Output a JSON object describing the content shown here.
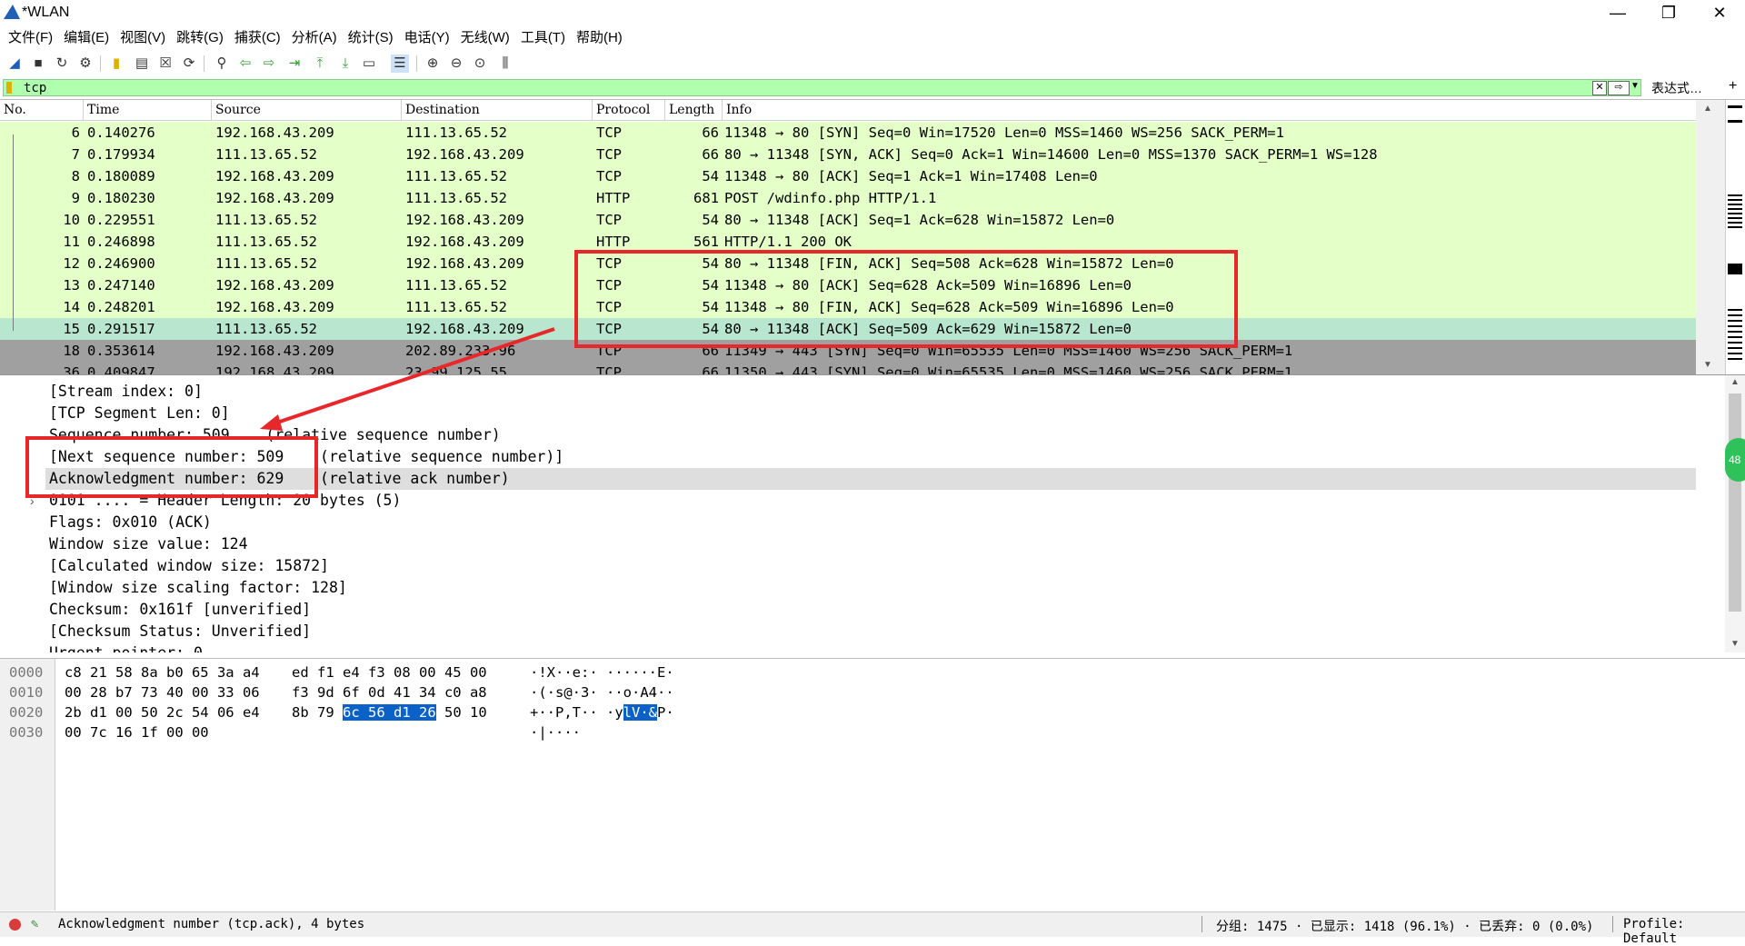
{
  "window": {
    "title": "*WLAN",
    "minimize": "—",
    "maximize": "❐",
    "close": "✕"
  },
  "menu": [
    "文件(F)",
    "编辑(E)",
    "视图(V)",
    "跳转(G)",
    "捕获(C)",
    "分析(A)",
    "统计(S)",
    "电话(Y)",
    "无线(W)",
    "工具(T)",
    "帮助(H)"
  ],
  "toolbar_icons": [
    "shark-start-icon",
    "stop-icon",
    "restart-icon",
    "options-icon",
    "open-icon",
    "save-icon",
    "close-file-icon",
    "reload-icon",
    "find-icon",
    "back-icon",
    "forward-icon",
    "goto-icon",
    "first-icon",
    "last-icon",
    "autoscroll-icon",
    "colorize-icon",
    "zoom-in-icon",
    "zoom-out-icon",
    "zoom-reset-icon",
    "resize-columns-icon"
  ],
  "filter": {
    "value": "tcp",
    "expression_label": "表达式…",
    "add_label": "+",
    "color": "#afffaf"
  },
  "packet_list": {
    "columns": [
      "No.",
      "Time",
      "Source",
      "Destination",
      "Protocol",
      "Length",
      "Info"
    ],
    "rows": [
      {
        "no": "6",
        "time": "0.140276",
        "src": "192.168.43.209",
        "dst": "111.13.65.52",
        "proto": "TCP",
        "len": "66",
        "info": "11348 → 80 [SYN] Seq=0 Win=17520 Len=0 MSS=1460 WS=256 SACK_PERM=1",
        "style": "green"
      },
      {
        "no": "7",
        "time": "0.179934",
        "src": "111.13.65.52",
        "dst": "192.168.43.209",
        "proto": "TCP",
        "len": "66",
        "info": "80 → 11348 [SYN, ACK] Seq=0 Ack=1 Win=14600 Len=0 MSS=1370 SACK_PERM=1 WS=128",
        "style": "green"
      },
      {
        "no": "8",
        "time": "0.180089",
        "src": "192.168.43.209",
        "dst": "111.13.65.52",
        "proto": "TCP",
        "len": "54",
        "info": "11348 → 80 [ACK] Seq=1 Ack=1 Win=17408 Len=0",
        "style": "green"
      },
      {
        "no": "9",
        "time": "0.180230",
        "src": "192.168.43.209",
        "dst": "111.13.65.52",
        "proto": "HTTP",
        "len": "681",
        "info": "POST /wdinfo.php HTTP/1.1",
        "style": "green"
      },
      {
        "no": "10",
        "time": "0.229551",
        "src": "111.13.65.52",
        "dst": "192.168.43.209",
        "proto": "TCP",
        "len": "54",
        "info": "80 → 11348 [ACK] Seq=1 Ack=628 Win=15872 Len=0",
        "style": "green"
      },
      {
        "no": "11",
        "time": "0.246898",
        "src": "111.13.65.52",
        "dst": "192.168.43.209",
        "proto": "HTTP",
        "len": "561",
        "info": "HTTP/1.1 200 OK",
        "style": "green"
      },
      {
        "no": "12",
        "time": "0.246900",
        "src": "111.13.65.52",
        "dst": "192.168.43.209",
        "proto": "TCP",
        "len": "54",
        "info": "80 → 11348 [FIN, ACK] Seq=508 Ack=628 Win=15872 Len=0",
        "style": "green"
      },
      {
        "no": "13",
        "time": "0.247140",
        "src": "192.168.43.209",
        "dst": "111.13.65.52",
        "proto": "TCP",
        "len": "54",
        "info": "11348 → 80 [ACK] Seq=628 Ack=509 Win=16896 Len=0",
        "style": "green"
      },
      {
        "no": "14",
        "time": "0.248201",
        "src": "192.168.43.209",
        "dst": "111.13.65.52",
        "proto": "TCP",
        "len": "54",
        "info": "11348 → 80 [FIN, ACK] Seq=628 Ack=509 Win=16896 Len=0",
        "style": "green"
      },
      {
        "no": "15",
        "time": "0.291517",
        "src": "111.13.65.52",
        "dst": "192.168.43.209",
        "proto": "TCP",
        "len": "54",
        "info": "80 → 11348 [ACK] Seq=509 Ack=629 Win=15872 Len=0",
        "style": "selected"
      },
      {
        "no": "18",
        "time": "0.353614",
        "src": "192.168.43.209",
        "dst": "202.89.233.96",
        "proto": "TCP",
        "len": "66",
        "info": "11349 → 443 [SYN] Seq=0 Win=65535 Len=0 MSS=1460 WS=256 SACK_PERM=1",
        "style": "gray"
      },
      {
        "no": "36",
        "time": "0.409847",
        "src": "192.168.43.209",
        "dst": "23.99.125.55",
        "proto": "TCP",
        "len": "66",
        "info": "11350 → 443 [SYN] Seq=0 Win=65535 Len=0 MSS=1460 WS=256 SACK_PERM=1",
        "style": "gray"
      }
    ]
  },
  "details": {
    "lines": [
      {
        "text": "[Stream index: 0]"
      },
      {
        "text": "[TCP Segment Len: 0]"
      },
      {
        "text": "Sequence number: 509    (relative sequence number)"
      },
      {
        "text": "[Next sequence number: 509    (relative sequence number)]"
      },
      {
        "text": "Acknowledgment number: 629    (relative ack number)",
        "highlight": true
      },
      {
        "text": "0101 .... = Header Length: 20 bytes (5)"
      },
      {
        "text": "Flags: 0x010 (ACK)",
        "expandable": true
      },
      {
        "text": "Window size value: 124"
      },
      {
        "text": "[Calculated window size: 15872]"
      },
      {
        "text": "[Window size scaling factor: 128]"
      },
      {
        "text": "Checksum: 0x161f [unverified]"
      },
      {
        "text": "[Checksum Status: Unverified]"
      },
      {
        "text": "Urgent pointer: 0"
      }
    ],
    "badge": "48"
  },
  "bytes": {
    "lines": [
      {
        "offset": "0000",
        "hex1": "c8 21 58 8a b0 65 3a a4",
        "hex2": "ed f1 e4 f3 08 00 45 00",
        "ascii": "·!X··e:· ······E·"
      },
      {
        "offset": "0010",
        "hex1": "00 28 b7 73 40 00 33 06",
        "hex2": "f3 9d 6f 0d 41 34 c0 a8",
        "ascii": "·(·s@·3· ··o·A4··"
      },
      {
        "offset": "0020",
        "hex1": "2b d1 00 50 2c 54 06 e4",
        "hex2a": "8b 79 ",
        "hex2sel": "6c 56 d1 26",
        "hex2b": " 50 10",
        "ascii_a": "+··P,T·· ·y",
        "ascii_sel": "lV·&",
        "ascii_b": "P·"
      },
      {
        "offset": "0030",
        "hex1": "00 7c 16 1f 00 00",
        "ascii": "·|····"
      }
    ]
  },
  "status": {
    "message": "Acknowledgment number (tcp.ack), 4 bytes",
    "packets": "分组: 1475 · 已显示: 1418 (96.1%) · 已丢弃: 0 (0.0%)",
    "profile": "Profile: Default"
  },
  "colors": {
    "row_green": "#e4ffc7",
    "row_selected": "#b8e6cf",
    "row_gray": "#a0a0a0",
    "annotation_red": "#e8272b",
    "byte_highlight": "#0a62c9"
  }
}
